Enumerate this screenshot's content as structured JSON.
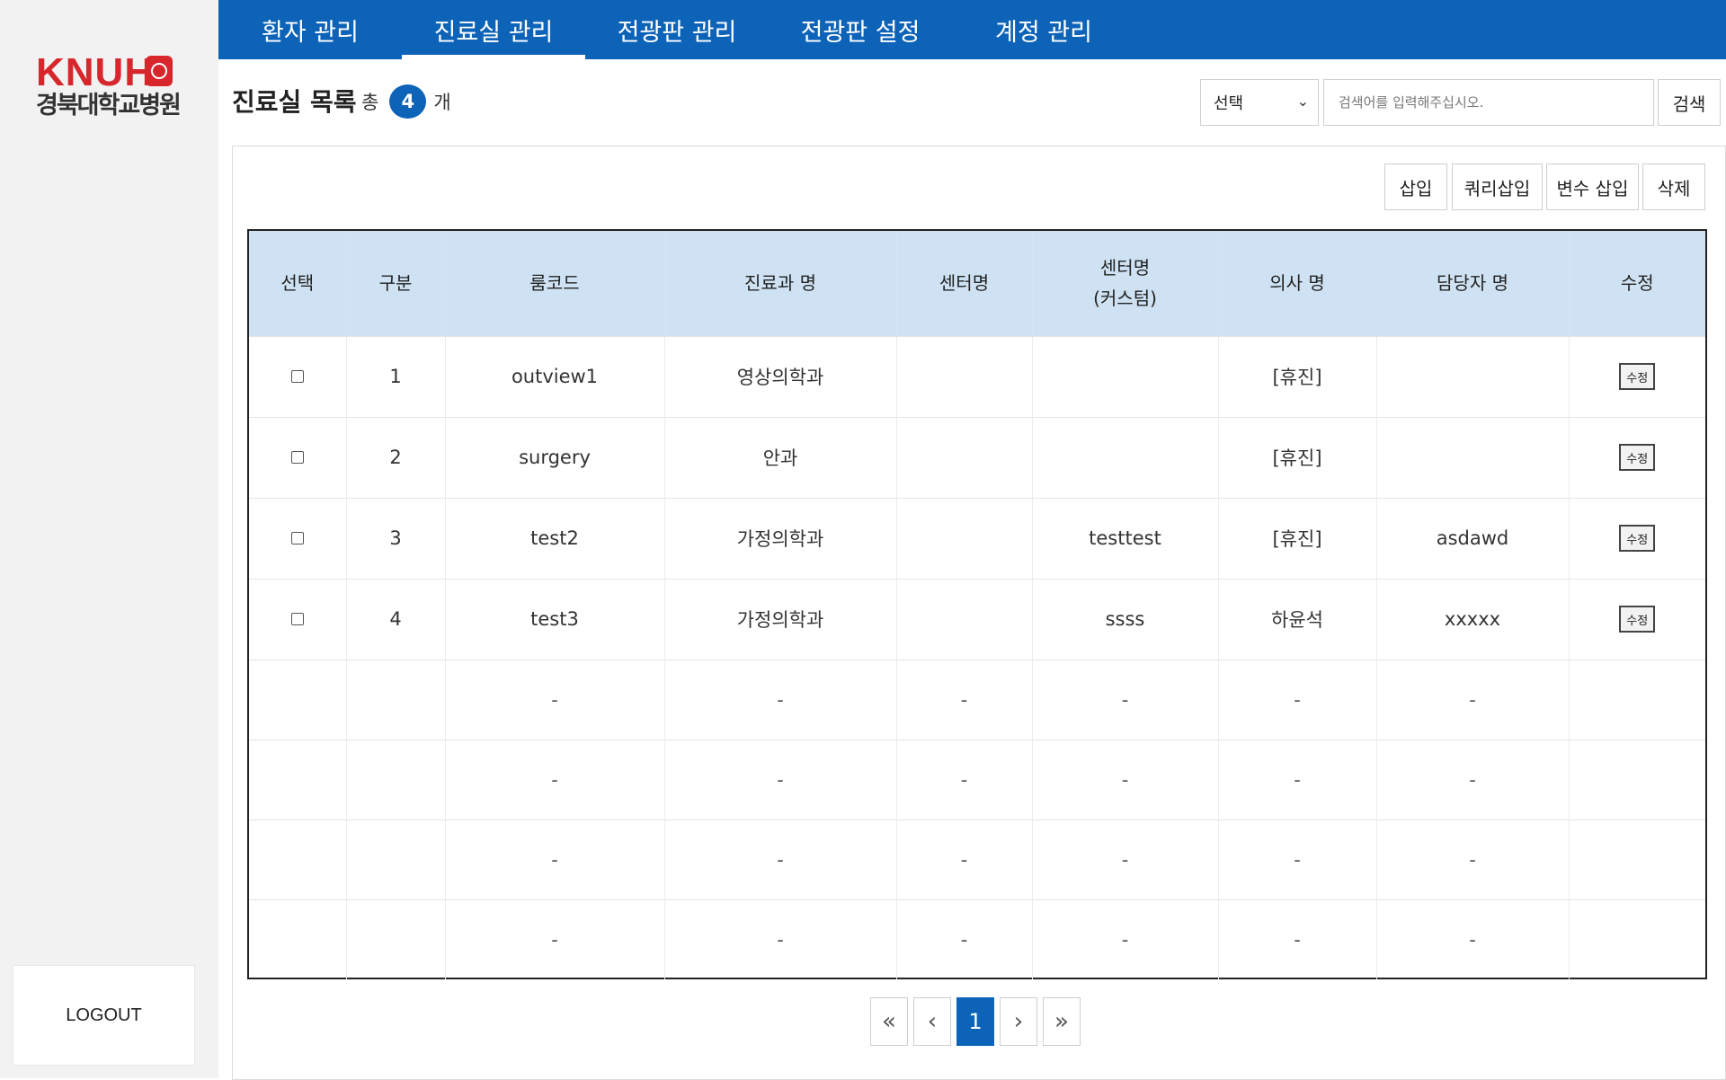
{
  "logo": {
    "text_en": "KNUH",
    "text_ko": "경북대학교병원"
  },
  "sidebar": {
    "logout_label": "LOGOUT"
  },
  "nav": {
    "items": [
      {
        "label": "환자 관리",
        "active": false
      },
      {
        "label": "진료실 관리",
        "active": true
      },
      {
        "label": "전광판 관리",
        "active": false
      },
      {
        "label": "전광판 설정",
        "active": false
      },
      {
        "label": "계정 관리",
        "active": false
      }
    ]
  },
  "header": {
    "title": "진료실 목록",
    "count_prefix": "총",
    "count_value": "4",
    "count_suffix": "개"
  },
  "search": {
    "select_value": "선택",
    "placeholder": "검색어를 입력해주십시오.",
    "button_label": "검색"
  },
  "actions": {
    "insert": "삽입",
    "query_insert": "쿼리삽입",
    "variable_insert": "변수 삽입",
    "delete": "삭제"
  },
  "table": {
    "columns": [
      "선택",
      "구분",
      "룸코드",
      "진료과 명",
      "센터명",
      "센터명\n(커스텀)",
      "의사 명",
      "담당자 명",
      "수정"
    ],
    "rows": [
      {
        "no": "1",
        "room_code": "outview1",
        "dept": "영상의학과",
        "center": "",
        "center_custom": "",
        "doctor": "[휴진]",
        "manager": "",
        "edit": "수정"
      },
      {
        "no": "2",
        "room_code": "surgery",
        "dept": "안과",
        "center": "",
        "center_custom": "",
        "doctor": "[휴진]",
        "manager": "",
        "edit": "수정"
      },
      {
        "no": "3",
        "room_code": "test2",
        "dept": "가정의학과",
        "center": "",
        "center_custom": "testtest",
        "doctor": "[휴진]",
        "manager": "asdawd",
        "edit": "수정"
      },
      {
        "no": "4",
        "room_code": "test3",
        "dept": "가정의학과",
        "center": "",
        "center_custom": "ssss",
        "doctor": "하윤석",
        "manager": "xxxxx",
        "edit": "수정"
      }
    ],
    "empty_row_placeholder": "-",
    "empty_rows": 4
  },
  "pagination": {
    "first": "«",
    "prev": "‹",
    "current": "1",
    "next": "›",
    "last": "»"
  }
}
